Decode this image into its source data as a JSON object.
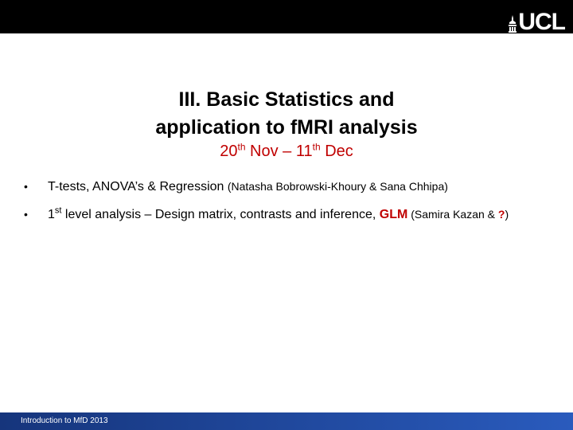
{
  "header": {
    "logo_text": "UCL",
    "logo_icon": "ucl-portico-icon",
    "bar_color": "#000000"
  },
  "title": {
    "line1": "III. Basic Statistics and",
    "line2": "application to fMRI analysis"
  },
  "dates": {
    "start_day": "20",
    "start_suffix": "th",
    "start_month": " Nov – 11",
    "end_suffix": "th",
    "end_month": " Dec",
    "color": "#c00000"
  },
  "bullets": [
    {
      "marker": "•",
      "topic": "T-tests, ANOVA’s & Regression ",
      "presenters": "(Natasha Bobrowski-Khoury & Sana Chhipa)"
    },
    {
      "marker": "•",
      "topic_num": "1",
      "topic_num_suffix": "st",
      "topic_rest": " level analysis – Design matrix, contrasts and inference, ",
      "highlight": "GLM",
      "presenters_open": " (Samira Kazan & ",
      "unknown": "?",
      "presenters_close": ")"
    }
  ],
  "footer": {
    "text": "Introduction to MfD 2013",
    "color_left": "#16357c",
    "color_right": "#2a5bbd"
  }
}
